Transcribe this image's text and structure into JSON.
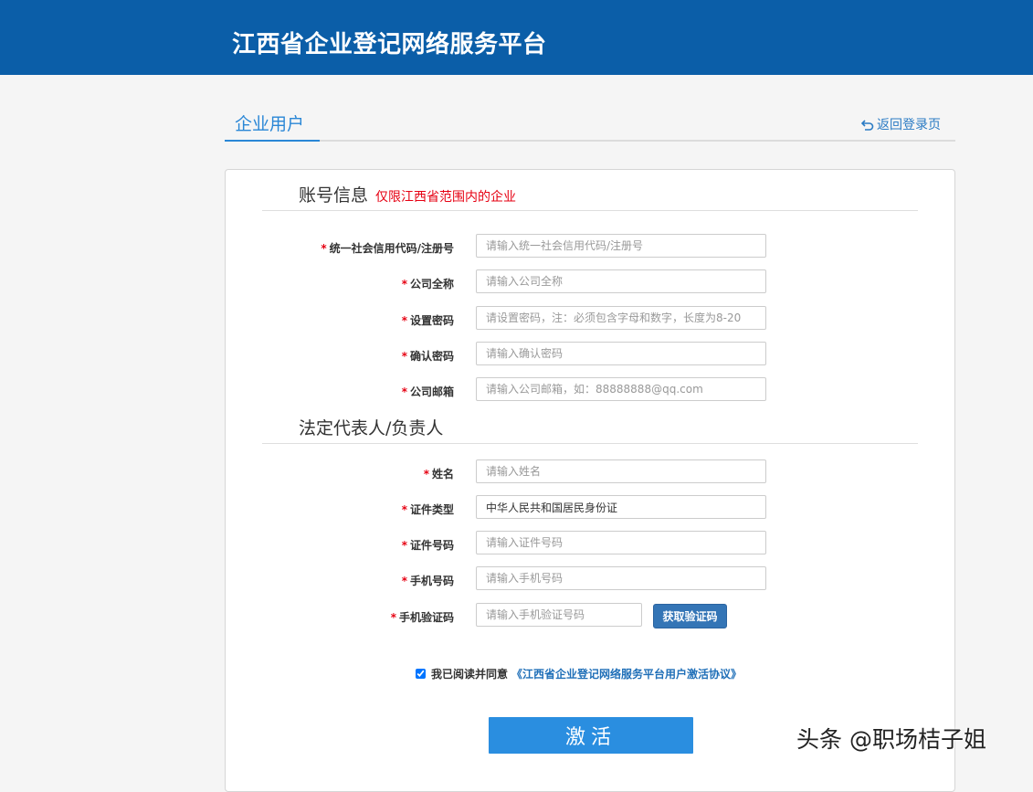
{
  "header": {
    "title": "江西省企业登记网络服务平台"
  },
  "tabs": {
    "active_label": "企业用户",
    "back_label": "返回登录页"
  },
  "account_section": {
    "title": "账号信息",
    "note": "仅限江西省范围内的企业"
  },
  "legal_section": {
    "title": "法定代表人/负责人"
  },
  "required_mark": "*",
  "fields": {
    "credit_code": {
      "label": "统一社会信用代码/注册号",
      "placeholder": "请输入统一社会信用代码/注册号"
    },
    "company_name": {
      "label": "公司全称",
      "placeholder": "请输入公司全称"
    },
    "password": {
      "label": "设置密码",
      "placeholder": "请设置密码，注：必须包含字母和数字，长度为8-20"
    },
    "confirm_password": {
      "label": "确认密码",
      "placeholder": "请输入确认密码"
    },
    "email": {
      "label": "公司邮箱",
      "placeholder": "请输入公司邮箱，如：88888888@qq.com"
    },
    "name": {
      "label": "姓名",
      "placeholder": "请输入姓名"
    },
    "id_type": {
      "label": "证件类型",
      "value": "中华人民共和国居民身份证"
    },
    "id_number": {
      "label": "证件号码",
      "placeholder": "请输入证件号码"
    },
    "phone": {
      "label": "手机号码",
      "placeholder": "请输入手机号码"
    },
    "sms_code": {
      "label": "手机验证码",
      "placeholder": "请输入手机验证号码"
    }
  },
  "sms_button_label": "获取验证码",
  "agreement": {
    "text": "我已阅读并同意",
    "link": "《江西省企业登记网络服务平台用户激活协议》",
    "checked": true
  },
  "activate_label": "激活",
  "watermark": "头条 @职场桔子姐",
  "colors": {
    "header_bg": "#0b5ea8",
    "accent": "#2a8ee0",
    "required": "#e60012"
  }
}
